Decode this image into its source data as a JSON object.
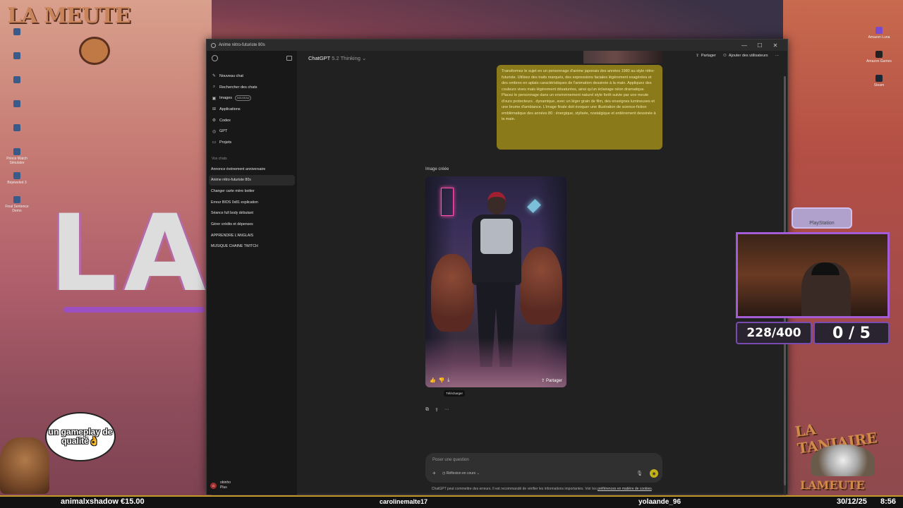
{
  "desktop": {
    "logo_text": "LA MEUTE",
    "big_text": "LA",
    "speech_bubble": "un gameplay de qualité👌",
    "left_icons": [
      {
        "label": "",
        "icon": "app-icon"
      },
      {
        "label": "",
        "icon": "app-icon"
      },
      {
        "label": "",
        "icon": "app-icon"
      },
      {
        "label": "",
        "icon": "app-icon"
      },
      {
        "label": "",
        "icon": "app-icon"
      },
      {
        "label": "Prince Watch Simulator",
        "icon": "app-icon"
      },
      {
        "label": "Bejeweled 3",
        "icon": "app-icon"
      },
      {
        "label": "Final Sentence Demo",
        "icon": "app-icon"
      }
    ],
    "right_icons": [
      {
        "label": "Amazon Luna",
        "icon": "luna-icon"
      },
      {
        "label": "Amazon Games",
        "icon": "amazon-games-icon"
      },
      {
        "label": "Steam",
        "icon": "steam-icon"
      }
    ],
    "counter_left": "228/400",
    "counter_right": "0 / 5",
    "ps_label": "PlayStation",
    "taniaire_top": "LA TANIAIRE",
    "taniaire_bottom": "LAMEUTE"
  },
  "window": {
    "title": "Anime rétro-futuriste 80s",
    "controls": [
      "—",
      "☐",
      "✕"
    ]
  },
  "sidebar": {
    "nav": [
      {
        "label": "Nouveau chat",
        "icon": "✎"
      },
      {
        "label": "Rechercher des chats",
        "icon": "⌕"
      },
      {
        "label": "Images",
        "icon": "▣",
        "badge": "NOUVEAU"
      },
      {
        "label": "Applications",
        "icon": "⊞"
      },
      {
        "label": "Codex",
        "icon": "⚙"
      },
      {
        "label": "GPT",
        "icon": "◎"
      },
      {
        "label": "Projets",
        "icon": "▭"
      }
    ],
    "section_label": "Vos chats",
    "chats": [
      "Annonce événement anniversaire",
      "Anime rétro-futuriste 80s",
      "Changer carte mère boitier",
      "Erreur BIOS 0x81 explication",
      "Séance full body débutant",
      "Gérer crédits et dépenses",
      "APPRENDRE L'ANGLAIS",
      "MUSIQUE CHAINE TWITCH"
    ],
    "user": {
      "name": "obinho",
      "plan": "Plus",
      "initials": "O"
    }
  },
  "topbar": {
    "model_name": "ChatGPT",
    "model_version": "5.2 Thinking",
    "share": "Partager",
    "add_users": "Ajouter des utilisateurs",
    "more": "···"
  },
  "conversation": {
    "user_message": "Transformez le sujet en un personnage d'anime japonais des années 1980 au style rétro-futuriste. Utilisez des traits marqués, des expressions faciales légèrement exagérées et des ombres en aplats caractéristiques de l'animation dessinée à la main. Appliquez des couleurs vives mais légèrement désaturées, ainsi qu'un éclairage néon dramatique. Placez le personnage dans un environnement naturel style forêt suivie par une meute d'ours protecteurs . dynamique, avec un léger grain de film, des enseignes lumineuses et une brume d'ambiance. L'image finale doit évoquer une illustration de science-fiction emblématique des années 80 : énergique, stylisée, nostalgique et entièrement dessinée à la main.",
    "image_label": "Image créée",
    "image_share": "Partager",
    "tooltip": "Télécharger"
  },
  "composer": {
    "placeholder": "Poser une question",
    "reasoning": "Réflexion en cours",
    "disclaimer": "ChatGPT peut commettre des erreurs. Il est recommandé de vérifier les informations importantes. Voir les ",
    "disclaimer_link": "préférences en matière de cookies",
    "disclaimer_end": "."
  },
  "ticker": {
    "donation": "animalxshadow €15.00",
    "follower": "carolinemalte17",
    "sub": "yolaande_96",
    "date": "30/12/25",
    "time": "8:56"
  },
  "colors": {
    "user_bubble": "#8a7a1a",
    "send_button": "#c4b21a",
    "webcam_border": "#a45bd6"
  }
}
